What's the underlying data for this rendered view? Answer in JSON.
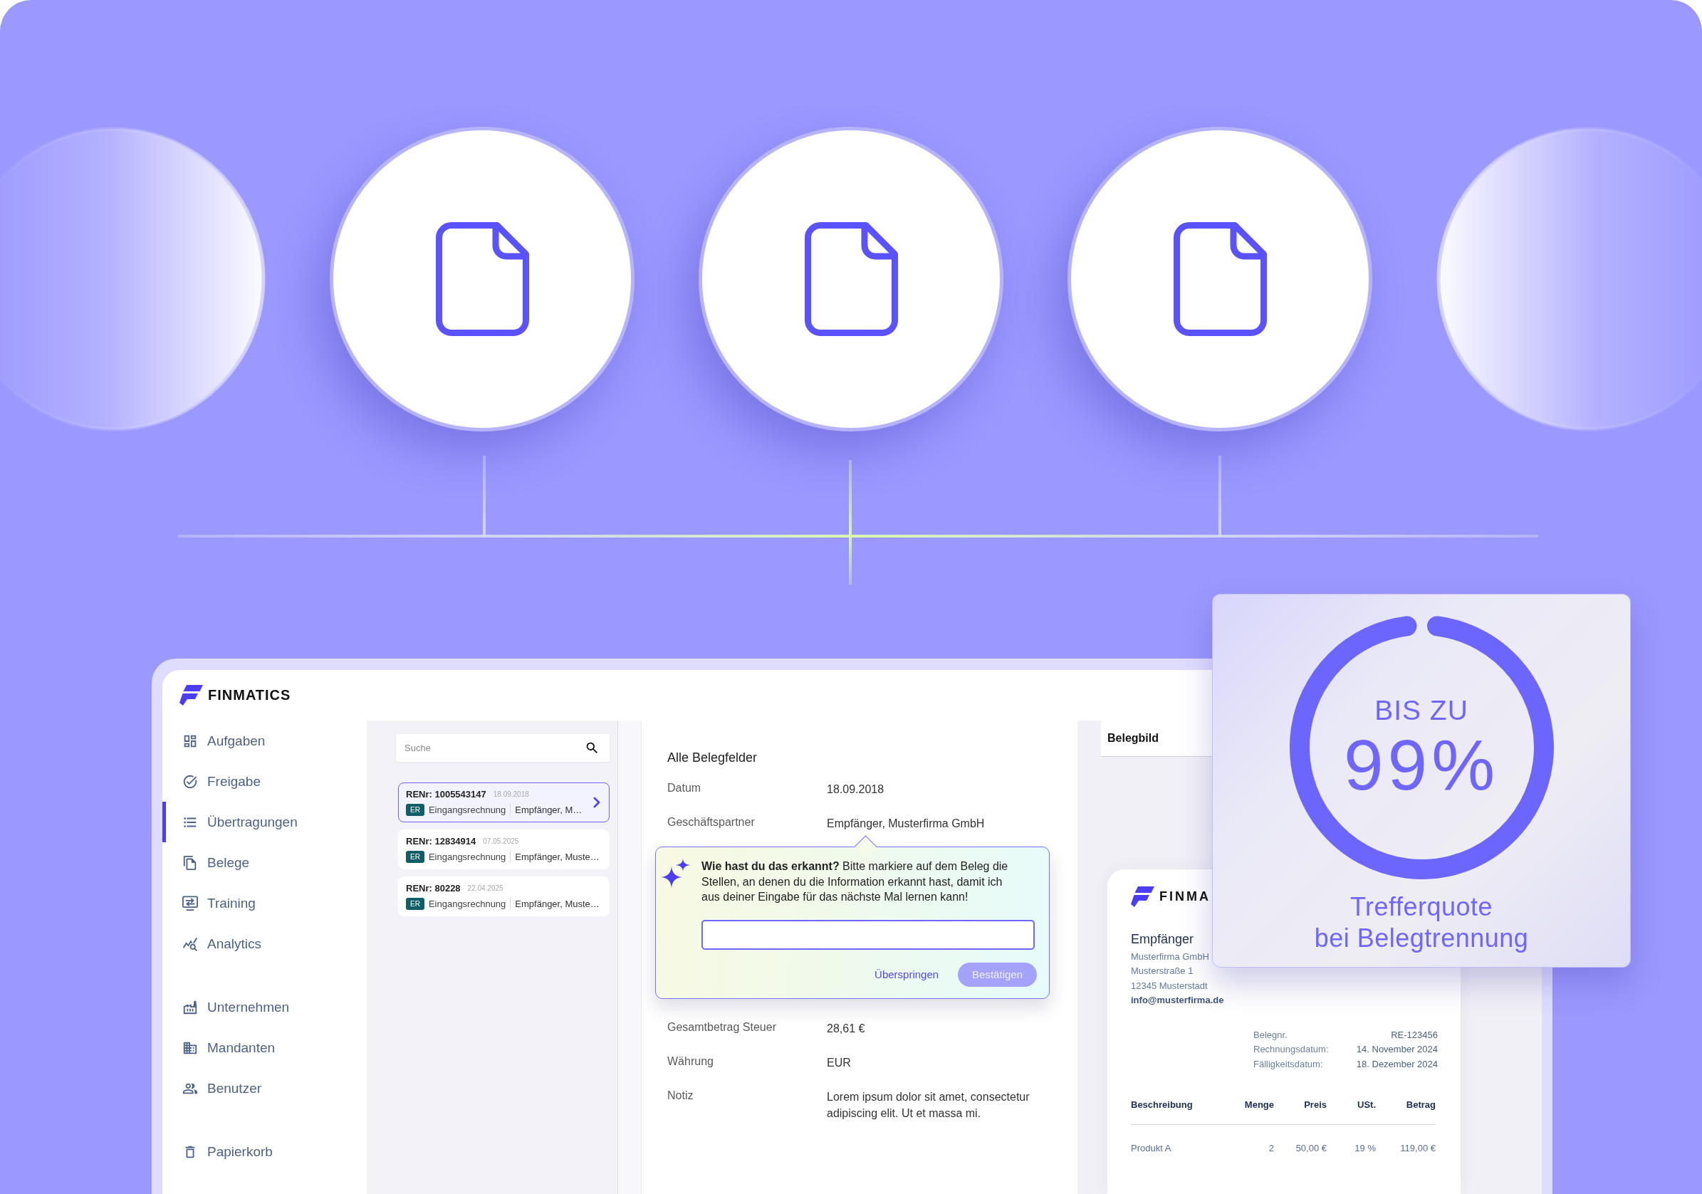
{
  "app": {
    "brand": "FINMATICS",
    "sidebar": {
      "sections": [
        {
          "items": [
            {
              "label": "Aufgaben",
              "selected": false
            },
            {
              "label": "Freigabe",
              "selected": false
            },
            {
              "label": "Übertragungen",
              "selected": true
            },
            {
              "label": "Belege",
              "selected": false
            },
            {
              "label": "Training",
              "selected": false
            },
            {
              "label": "Analytics",
              "selected": false
            }
          ]
        },
        {
          "items": [
            {
              "label": "Unternehmen",
              "selected": false
            },
            {
              "label": "Mandanten",
              "selected": false
            },
            {
              "label": "Benutzer",
              "selected": false
            }
          ]
        },
        {
          "items": [
            {
              "label": "Papierkorb",
              "selected": false
            }
          ]
        }
      ]
    },
    "transfers": {
      "search": {
        "placeholder": "Suche"
      },
      "items": [
        {
          "number": "RENr: 1005543147",
          "date": "18.09.2018",
          "tag": "ER",
          "type": "Eingangsrechnung",
          "partner": "Empfänger, M…",
          "selected": true
        },
        {
          "number": "RENr: 12834914",
          "date": "07.05.2025",
          "tag": "ER",
          "type": "Eingangsrechnung",
          "partner": "Empfänger, Muste…",
          "selected": false
        },
        {
          "number": "RENr: 80228",
          "date": "22.04.2025",
          "tag": "ER",
          "type": "Eingangsrechnung",
          "partner": "Empfänger, Muste…",
          "selected": false
        }
      ]
    },
    "details": {
      "title": "Alle Belegfelder",
      "rows": [
        {
          "kind": "field",
          "label": "Datum",
          "value": "18.09.2018"
        },
        {
          "kind": "field",
          "label": "Geschäftspartner",
          "value": "Empfänger, Musterfirma GmbH"
        },
        {
          "kind": "hint",
          "text": "**Wie hast du das erkannt?** Bitte markiere auf dem Beleg die Stellen, an denen du die Information erkannt hast, damit ich aus deiner Eingabe für das nächste Mal lernen kann!",
          "actions": [
            {
              "kind": "link",
              "label": "Überspringen",
              "disabled": false
            },
            {
              "kind": "primary",
              "label": "Bestätigen",
              "disabled": true
            }
          ]
        },
        {
          "kind": "field",
          "label": "Gesamtbetrag Steuer",
          "value": "28,61 €"
        },
        {
          "kind": "field",
          "label": "Währung",
          "value": "EUR"
        },
        {
          "kind": "field",
          "label": "Notiz",
          "value": "Lorem ipsum dolor sit amet, consectetur adipiscing elit. Ut et massa mi."
        }
      ]
    },
    "receipt": {
      "title": "Belegbild",
      "document": {
        "brand": "FINMA",
        "recipient_title": "Empfänger",
        "address": [
          "Musterfirma GmbH",
          "Musterstraße 1",
          "12345 Musterstadt"
        ],
        "email": "info@musterfirma.de",
        "meta": [
          {
            "label": "Belegnr.",
            "value": "RE-123456"
          },
          {
            "label": "Rechnungsdatum:",
            "value": "14. November 2024"
          },
          {
            "label": "Fälligkeitsdatum:",
            "value": "18. Dezember 2024"
          }
        ],
        "table": {
          "columns": [
            "Beschreibung",
            "Menge",
            "Preis",
            "USt.",
            "Betrag"
          ],
          "rows": [
            {
              "cells": [
                "Produkt A",
                "2",
                "50,00 €",
                "19 %",
                "119,00 €"
              ]
            }
          ]
        }
      }
    }
  },
  "stat": {
    "prefix": "BIS ZU",
    "value": "99%",
    "ring": {
      "level": 0.96
    },
    "caption": [
      "Trefferquote",
      "bei Belegtrennung"
    ]
  }
}
